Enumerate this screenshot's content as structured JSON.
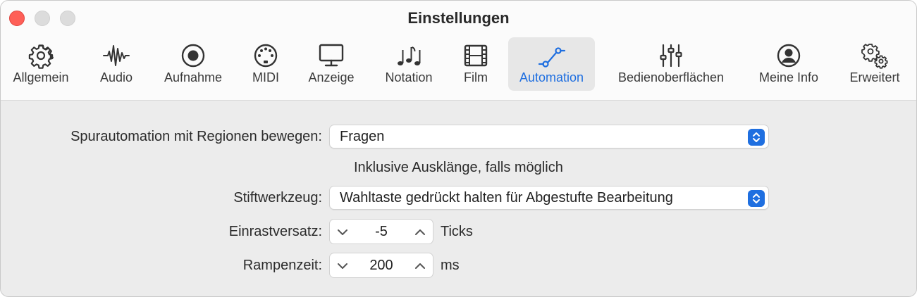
{
  "window": {
    "title": "Einstellungen"
  },
  "tabs": [
    {
      "label": "Allgemein",
      "icon": "gear-icon"
    },
    {
      "label": "Audio",
      "icon": "waveform-icon"
    },
    {
      "label": "Aufnahme",
      "icon": "record-icon"
    },
    {
      "label": "MIDI",
      "icon": "midi-port-icon"
    },
    {
      "label": "Anzeige",
      "icon": "display-icon"
    },
    {
      "label": "Notation",
      "icon": "notes-icon"
    },
    {
      "label": "Film",
      "icon": "film-icon"
    },
    {
      "label": "Automation",
      "icon": "automation-icon",
      "active": true
    },
    {
      "label": "Bedienoberflächen",
      "icon": "sliders-icon"
    },
    {
      "label": "Meine Info",
      "icon": "person-icon"
    },
    {
      "label": "Erweitert",
      "icon": "gears-icon"
    }
  ],
  "settings": {
    "track_automation": {
      "label": "Spurautomation mit Regionen bewegen:",
      "value": "Fragen"
    },
    "include_tails": {
      "label": "Inklusive Ausklänge, falls möglich",
      "checked": true
    },
    "pencil_tool": {
      "label": "Stiftwerkzeug:",
      "value": "Wahltaste gedrückt halten für Abgestufte Bearbeitung"
    },
    "snap_offset": {
      "label": "Einrastversatz:",
      "value": "-5",
      "unit": "Ticks"
    },
    "ramp_time": {
      "label": "Rampenzeit:",
      "value": "200",
      "unit": "ms"
    }
  },
  "colors": {
    "accent": "#1f6fe0",
    "close": "#fe5f57"
  }
}
